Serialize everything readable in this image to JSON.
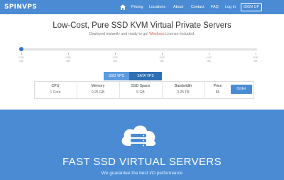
{
  "nav": {
    "logo": "SPINVPS",
    "links": [
      "Pricing",
      "Locations",
      "About",
      "Contact",
      "FAQ",
      "Log In"
    ],
    "signup": "SIGN UP",
    "home_icon": "home-icon"
  },
  "hero": {
    "title": "Low-Cost, Pure SSD KVM Virtual Private Servers",
    "subtitle_before": "Deployed instantly and ready to go!",
    "subtitle_highlight": "Windows",
    "subtitle_after": "License Included.",
    "highlight_color": "#e05555"
  },
  "slider": {
    "level": 0,
    "ticks": [
      {
        "price": "0.25",
        "unit": "GB"
      },
      {
        "price": "0.50",
        "unit": "GB"
      },
      {
        "price": "1.00",
        "unit": "GB"
      },
      {
        "price": "2.00",
        "unit": "GB"
      },
      {
        "price": "4.00",
        "unit": "GB"
      },
      {
        "price": "8.00",
        "unit": "GB"
      }
    ]
  },
  "tabs": [
    "SSD VPS",
    "SATA VPS"
  ],
  "plan": {
    "columns": [
      {
        "header": "CPU",
        "value": "1 Core"
      },
      {
        "header": "Memory",
        "value": "0.25 GB"
      },
      {
        "header": "SSD Space",
        "value": "5 GB"
      },
      {
        "header": "Bandwidth",
        "value": "0.25 TB"
      },
      {
        "header": "Price",
        "value": "$5"
      }
    ],
    "order_label": "Order"
  },
  "feature": {
    "heading": "FAST SSD VIRTUAL SERVERS",
    "tagline": "We guarantee the best I/O performance",
    "icon": "cloud-server-icon"
  },
  "colors": {
    "brand": "#4a8bd4",
    "tab_active": "#5d9be0",
    "tab_dark": "#2f6fb3"
  }
}
